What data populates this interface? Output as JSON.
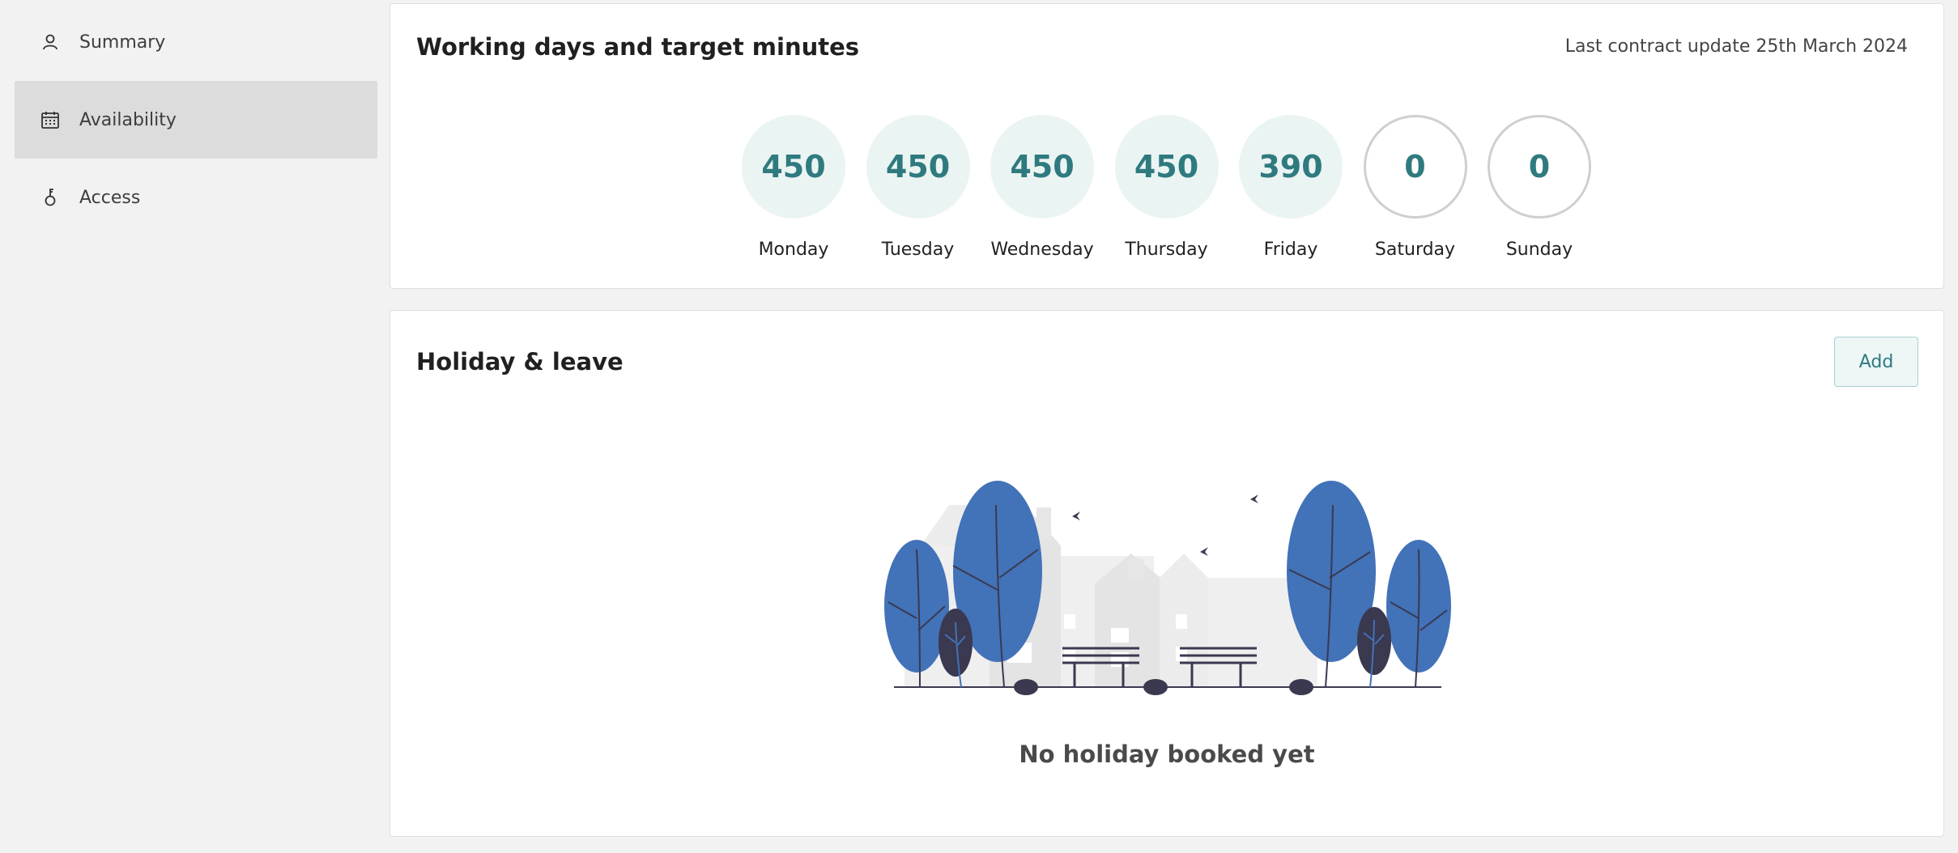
{
  "sidebar": {
    "items": [
      {
        "label": "Summary",
        "icon": "user-icon",
        "active": false
      },
      {
        "label": "Availability",
        "icon": "calendar-icon",
        "active": true
      },
      {
        "label": "Access",
        "icon": "key-icon",
        "active": false
      }
    ]
  },
  "working_days": {
    "title": "Working days and target minutes",
    "contract_note": "Last contract update 25th March 2024",
    "days": [
      {
        "label": "Monday",
        "minutes": "450"
      },
      {
        "label": "Tuesday",
        "minutes": "450"
      },
      {
        "label": "Wednesday",
        "minutes": "450"
      },
      {
        "label": "Thursday",
        "minutes": "450"
      },
      {
        "label": "Friday",
        "minutes": "390"
      },
      {
        "label": "Saturday",
        "minutes": "0"
      },
      {
        "label": "Sunday",
        "minutes": "0"
      }
    ]
  },
  "holiday": {
    "title": "Holiday & leave",
    "add_label": "Add",
    "empty_text": "No holiday booked yet"
  },
  "colors": {
    "accent": "#2f7a7f",
    "accent_bg": "#eaf4f3",
    "tree_blue": "#4272b8",
    "tree_dark": "#3a3950"
  }
}
